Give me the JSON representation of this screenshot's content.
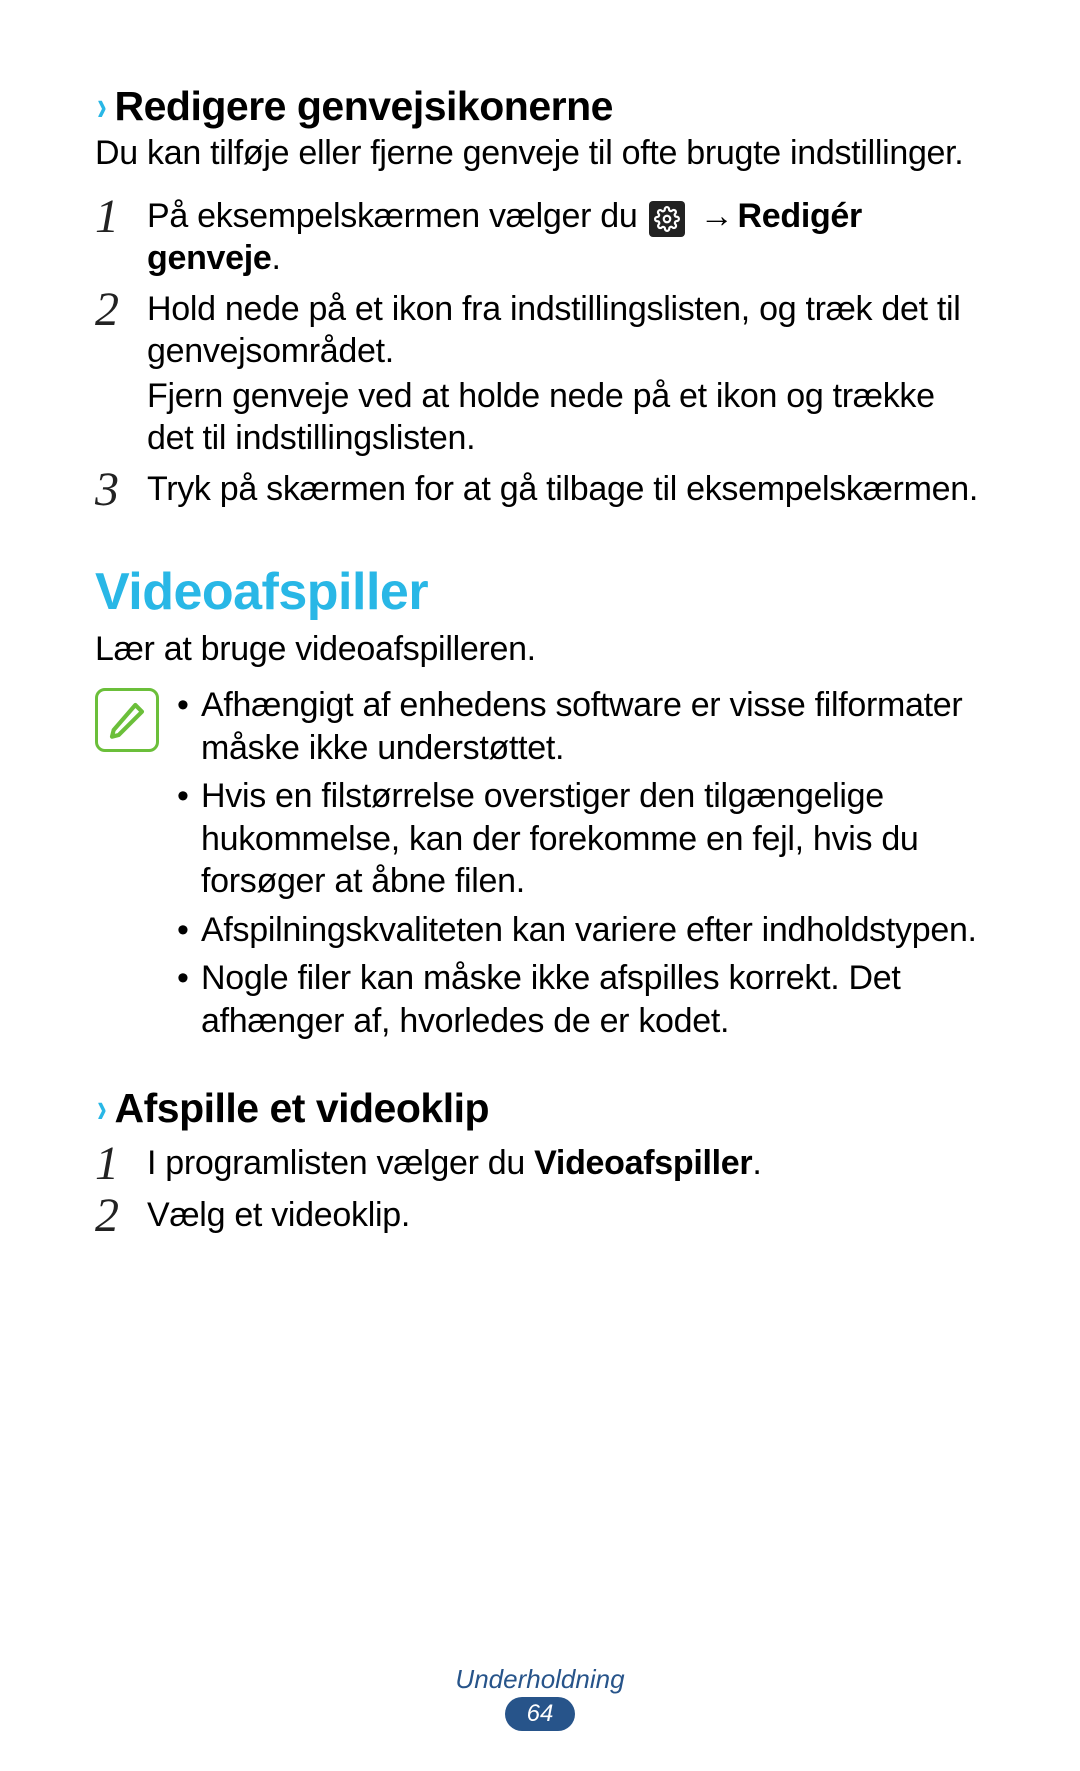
{
  "section1": {
    "heading": "Redigere genvejsikonerne",
    "intro": "Du kan tilføje eller fjerne genveje til ofte brugte indstillinger.",
    "steps": [
      {
        "num": "1",
        "pre": "På eksempelskærmen vælger du ",
        "arrow": "→",
        "bold": "Redigér genveje",
        "post": "."
      },
      {
        "num": "2",
        "line1": "Hold nede på et ikon fra indstillingslisten, og træk det til genvejsområdet.",
        "line2": "Fjern genveje ved at holde nede på et ikon og trække det til indstillingslisten."
      },
      {
        "num": "3",
        "line1": "Tryk på skærmen for at gå tilbage til eksempelskærmen."
      }
    ]
  },
  "section2": {
    "heading": "Videoafspiller",
    "intro": "Lær at bruge videoafspilleren.",
    "notes": [
      "Afhængigt af enhedens software er visse filformater måske ikke understøttet.",
      "Hvis en filstørrelse overstiger den tilgængelige hukommelse, kan der forekomme en fejl, hvis du forsøger at åbne filen.",
      "Afspilningskvaliteten kan variere efter indholdstypen.",
      "Nogle filer kan måske ikke afspilles korrekt. Det afhænger af, hvorledes de er kodet."
    ]
  },
  "section3": {
    "heading": "Afspille et videoklip",
    "steps": [
      {
        "num": "1",
        "pre": "I programlisten vælger du ",
        "bold": "Videoafspiller",
        "post": "."
      },
      {
        "num": "2",
        "line1": "Vælg et videoklip."
      }
    ]
  },
  "footer": {
    "label": "Underholdning",
    "page": "64"
  }
}
